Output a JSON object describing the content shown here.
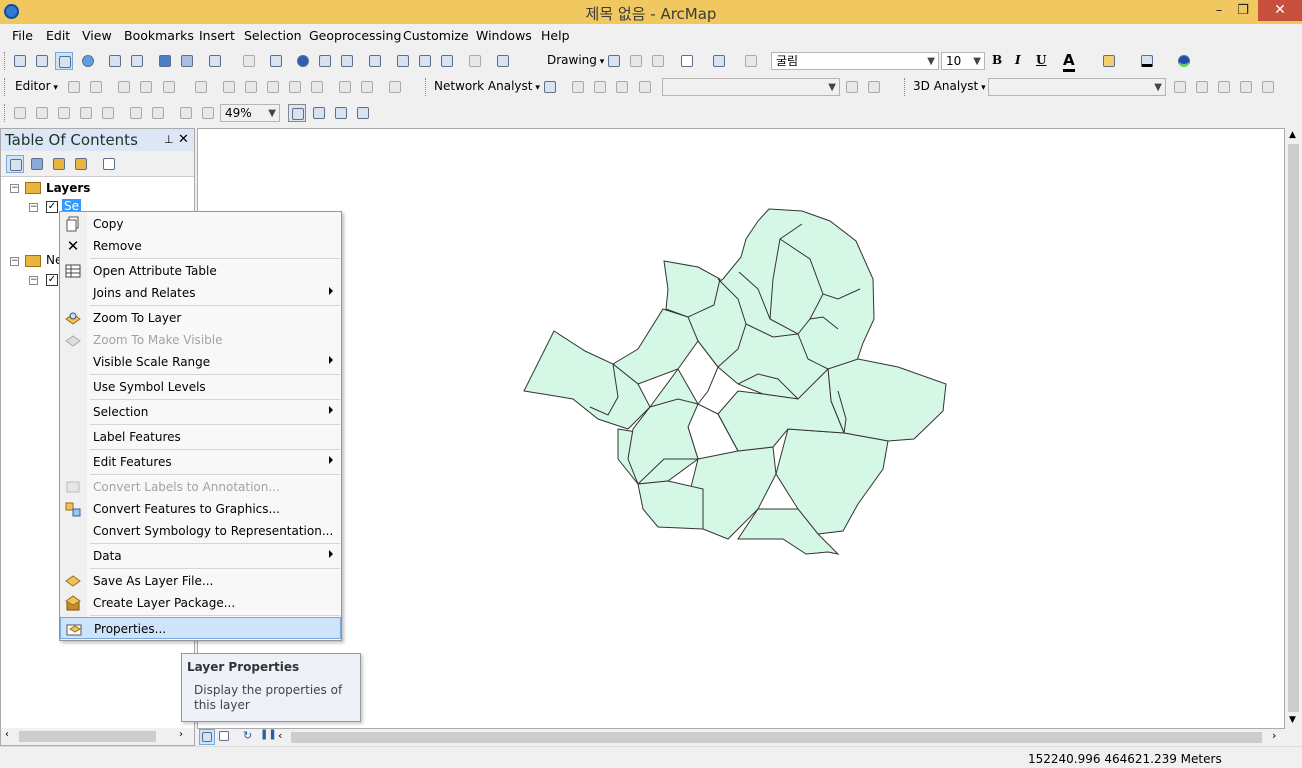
{
  "window": {
    "title": "제목 없음 - ArcMap",
    "minimize": "–",
    "restore": "❐",
    "close": "✕"
  },
  "menu": [
    "File",
    "Edit",
    "View",
    "Bookmarks",
    "Insert",
    "Selection",
    "Geoprocessing",
    "Customize",
    "Windows",
    "Help"
  ],
  "toolbar": {
    "drawing": "Drawing",
    "font_name": "굴림",
    "font_size": "10",
    "bold": "B",
    "italic": "I",
    "underline": "U",
    "font_color": "A",
    "editor": "Editor",
    "network_analyst": "Network Analyst",
    "analyst_3d": "3D Analyst",
    "zoom_level": "49%"
  },
  "toc": {
    "title": "Table Of Contents",
    "pin": "ᵖ",
    "close": "✕",
    "group1": "Layers",
    "layer1": "Se",
    "group2": "Ne"
  },
  "context_menu": {
    "items": [
      {
        "label": "Copy",
        "icon": "copy-icon"
      },
      {
        "label": "Remove",
        "icon": "remove-icon"
      },
      {
        "label": "Open Attribute Table",
        "icon": "table-icon"
      },
      {
        "label": "Joins and Relates",
        "icon": ""
      },
      {
        "label": "Zoom To Layer",
        "icon": "zoom-to-layer-icon"
      },
      {
        "label": "Zoom To Make Visible",
        "icon": "zoom-visible-icon"
      },
      {
        "label": "Visible Scale Range",
        "icon": ""
      },
      {
        "label": "Use Symbol Levels",
        "icon": ""
      },
      {
        "label": "Selection",
        "icon": ""
      },
      {
        "label": "Label Features",
        "icon": ""
      },
      {
        "label": "Edit Features",
        "icon": ""
      },
      {
        "label": "Convert Labels to Annotation...",
        "icon": "convert-labels-icon"
      },
      {
        "label": "Convert Features to Graphics...",
        "icon": "convert-features-icon"
      },
      {
        "label": "Convert Symbology to Representation...",
        "icon": ""
      },
      {
        "label": "Data",
        "icon": ""
      },
      {
        "label": "Save As Layer File...",
        "icon": "save-layer-icon"
      },
      {
        "label": "Create Layer Package...",
        "icon": "layer-package-icon"
      },
      {
        "label": "Properties...",
        "icon": "properties-icon"
      }
    ]
  },
  "tooltip": {
    "title": "Layer Properties",
    "text": "Display the properties of this layer"
  },
  "status": {
    "coordinates": "152240.996  464621.239 Meters"
  },
  "colors": {
    "map_fill": "#d5f7e6",
    "map_stroke": "#333333",
    "title_bar": "#f1c75f",
    "selection": "#cde4fb"
  }
}
